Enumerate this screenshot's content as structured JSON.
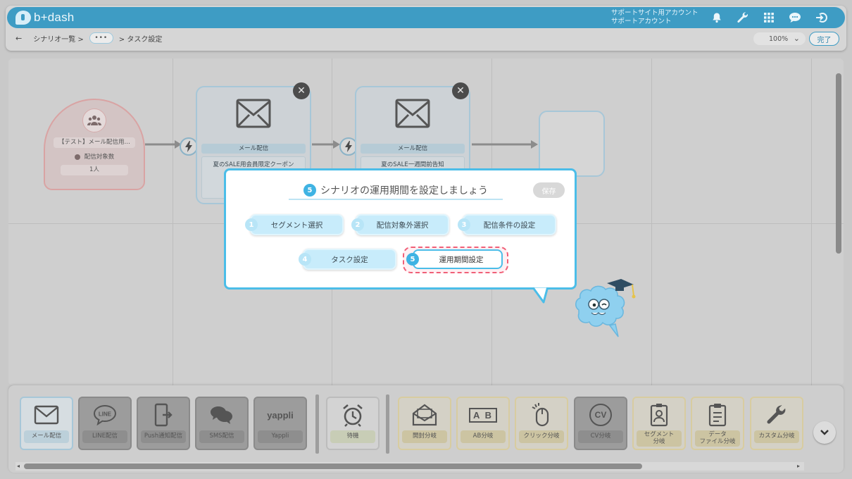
{
  "app": {
    "brand": "b+dash"
  },
  "account": {
    "line1": "サポートサイト用アカウント",
    "line2": "サポートアカウント"
  },
  "header_icons": [
    "bell-icon",
    "wrench-icon",
    "grid-icon",
    "chat-icon",
    "logout-icon"
  ],
  "breadcrumb": {
    "back": "←",
    "items": [
      "シナリオ一覧 >",
      "•••",
      "> タスク設定"
    ]
  },
  "zoom": {
    "value": "100%",
    "caret": "⌄"
  },
  "done_label": "完了",
  "canvas": {
    "start_node": {
      "title": "【テスト】メール配信用…",
      "count_label": "配信対象数",
      "count_value": "1人"
    },
    "task_nodes": [
      {
        "label": "メール配信",
        "subject": "夏のSALE用会員限定クーポン"
      },
      {
        "label": "メール配信",
        "subject": "夏のSALE一週間前告知"
      }
    ]
  },
  "dialog": {
    "step_number": "5",
    "title": "シナリオの運用期間を設定しましょう",
    "save_label": "保存",
    "steps": [
      {
        "num": "1",
        "label": "セグメント選択"
      },
      {
        "num": "2",
        "label": "配信対象外選択"
      },
      {
        "num": "3",
        "label": "配信条件の設定"
      },
      {
        "num": "4",
        "label": "タスク設定"
      },
      {
        "num": "5",
        "label": "運用期間設定"
      }
    ],
    "current_step": 5
  },
  "palette": {
    "tasks": [
      {
        "label": "メール配信",
        "icon": "mail-icon"
      },
      {
        "label": "LINE配信",
        "icon": "line-icon"
      },
      {
        "label": "Push通知配信",
        "icon": "push-icon"
      },
      {
        "label": "SMS配信",
        "icon": "sms-icon"
      },
      {
        "label": "Yappli",
        "icon": "yappli-icon",
        "logo_text": "yappli"
      }
    ],
    "wait": {
      "label": "待機",
      "icon": "alarm-clock-icon"
    },
    "branches": [
      {
        "label": "開封分岐",
        "icon": "open-mail-icon"
      },
      {
        "label": "AB分岐",
        "icon": "ab-icon",
        "logo_text": "A B"
      },
      {
        "label": "クリック分岐",
        "icon": "mouse-icon"
      },
      {
        "label": "CV分岐",
        "icon": "cv-icon",
        "logo_text": "CV"
      },
      {
        "label": "セグメント\n分岐",
        "icon": "badge-icon"
      },
      {
        "label": "データ\nファイル分岐",
        "icon": "clipboard-icon"
      },
      {
        "label": "カスタム分岐",
        "icon": "wrench-icon"
      }
    ]
  },
  "colors": {
    "brand": "#3e9cc4",
    "dialog_border": "#4bbde8",
    "highlight": "#f05f77",
    "step_bg": "#c8ecfb"
  }
}
